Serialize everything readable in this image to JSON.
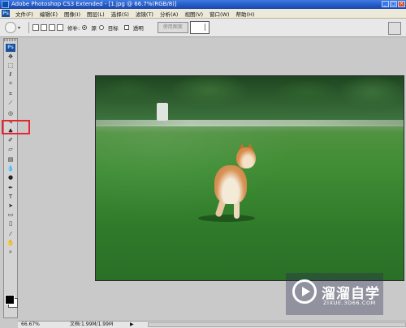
{
  "window": {
    "title": "Adobe Photoshop CS3 Extended - [1.jpg @ 66.7%(RGB/8)]",
    "buttons": [
      "_",
      "□",
      "×"
    ]
  },
  "menubar": {
    "logo": "Ps",
    "items": [
      "文件(F)",
      "编辑(E)",
      "图像(I)",
      "图层(L)",
      "选择(S)",
      "滤镜(T)",
      "分析(A)",
      "视图(V)",
      "窗口(W)",
      "帮助(H)"
    ]
  },
  "options": {
    "repair_label": "修补:",
    "source_label": "源",
    "target_label": "目标",
    "transparent_label": "透明",
    "source_selected": true,
    "use_pattern_label": "使用图案"
  },
  "toolbox": {
    "badge": "Ps",
    "tools": [
      {
        "name": "move-tool-icon",
        "glyph": "✥"
      },
      {
        "name": "marquee-tool-icon",
        "glyph": "⬚"
      },
      {
        "name": "lasso-tool-icon",
        "glyph": "ℓ"
      },
      {
        "name": "magic-wand-tool-icon",
        "glyph": "✧"
      },
      {
        "name": "crop-tool-icon",
        "glyph": "⌗"
      },
      {
        "name": "slice-tool-icon",
        "glyph": "⟋"
      },
      {
        "name": "patch-tool-icon",
        "glyph": "◎"
      },
      {
        "name": "brush-tool-icon",
        "glyph": "✎"
      },
      {
        "name": "stamp-tool-icon",
        "glyph": "♣"
      },
      {
        "name": "history-brush-icon",
        "glyph": "✐"
      },
      {
        "name": "eraser-tool-icon",
        "glyph": "▱"
      },
      {
        "name": "gradient-tool-icon",
        "glyph": "▤"
      },
      {
        "name": "blur-tool-icon",
        "glyph": "💧"
      },
      {
        "name": "dodge-tool-icon",
        "glyph": "●"
      },
      {
        "name": "pen-tool-icon",
        "glyph": "✒"
      },
      {
        "name": "type-tool-icon",
        "glyph": "T"
      },
      {
        "name": "path-selection-icon",
        "glyph": "➤"
      },
      {
        "name": "shape-tool-icon",
        "glyph": "▭"
      },
      {
        "name": "notes-tool-icon",
        "glyph": "▯"
      },
      {
        "name": "eyedropper-tool-icon",
        "glyph": "⁄"
      },
      {
        "name": "hand-tool-icon",
        "glyph": "✋"
      },
      {
        "name": "zoom-tool-icon",
        "glyph": "⌕"
      }
    ],
    "highlight_color": "#e8262d"
  },
  "watermark": {
    "brand": "溜溜自学",
    "url": "ZIXUE.3D66.COM"
  },
  "status": {
    "zoom": "66.67%",
    "doc": "文档:1.99M/1.99M",
    "arrow": "▶"
  }
}
